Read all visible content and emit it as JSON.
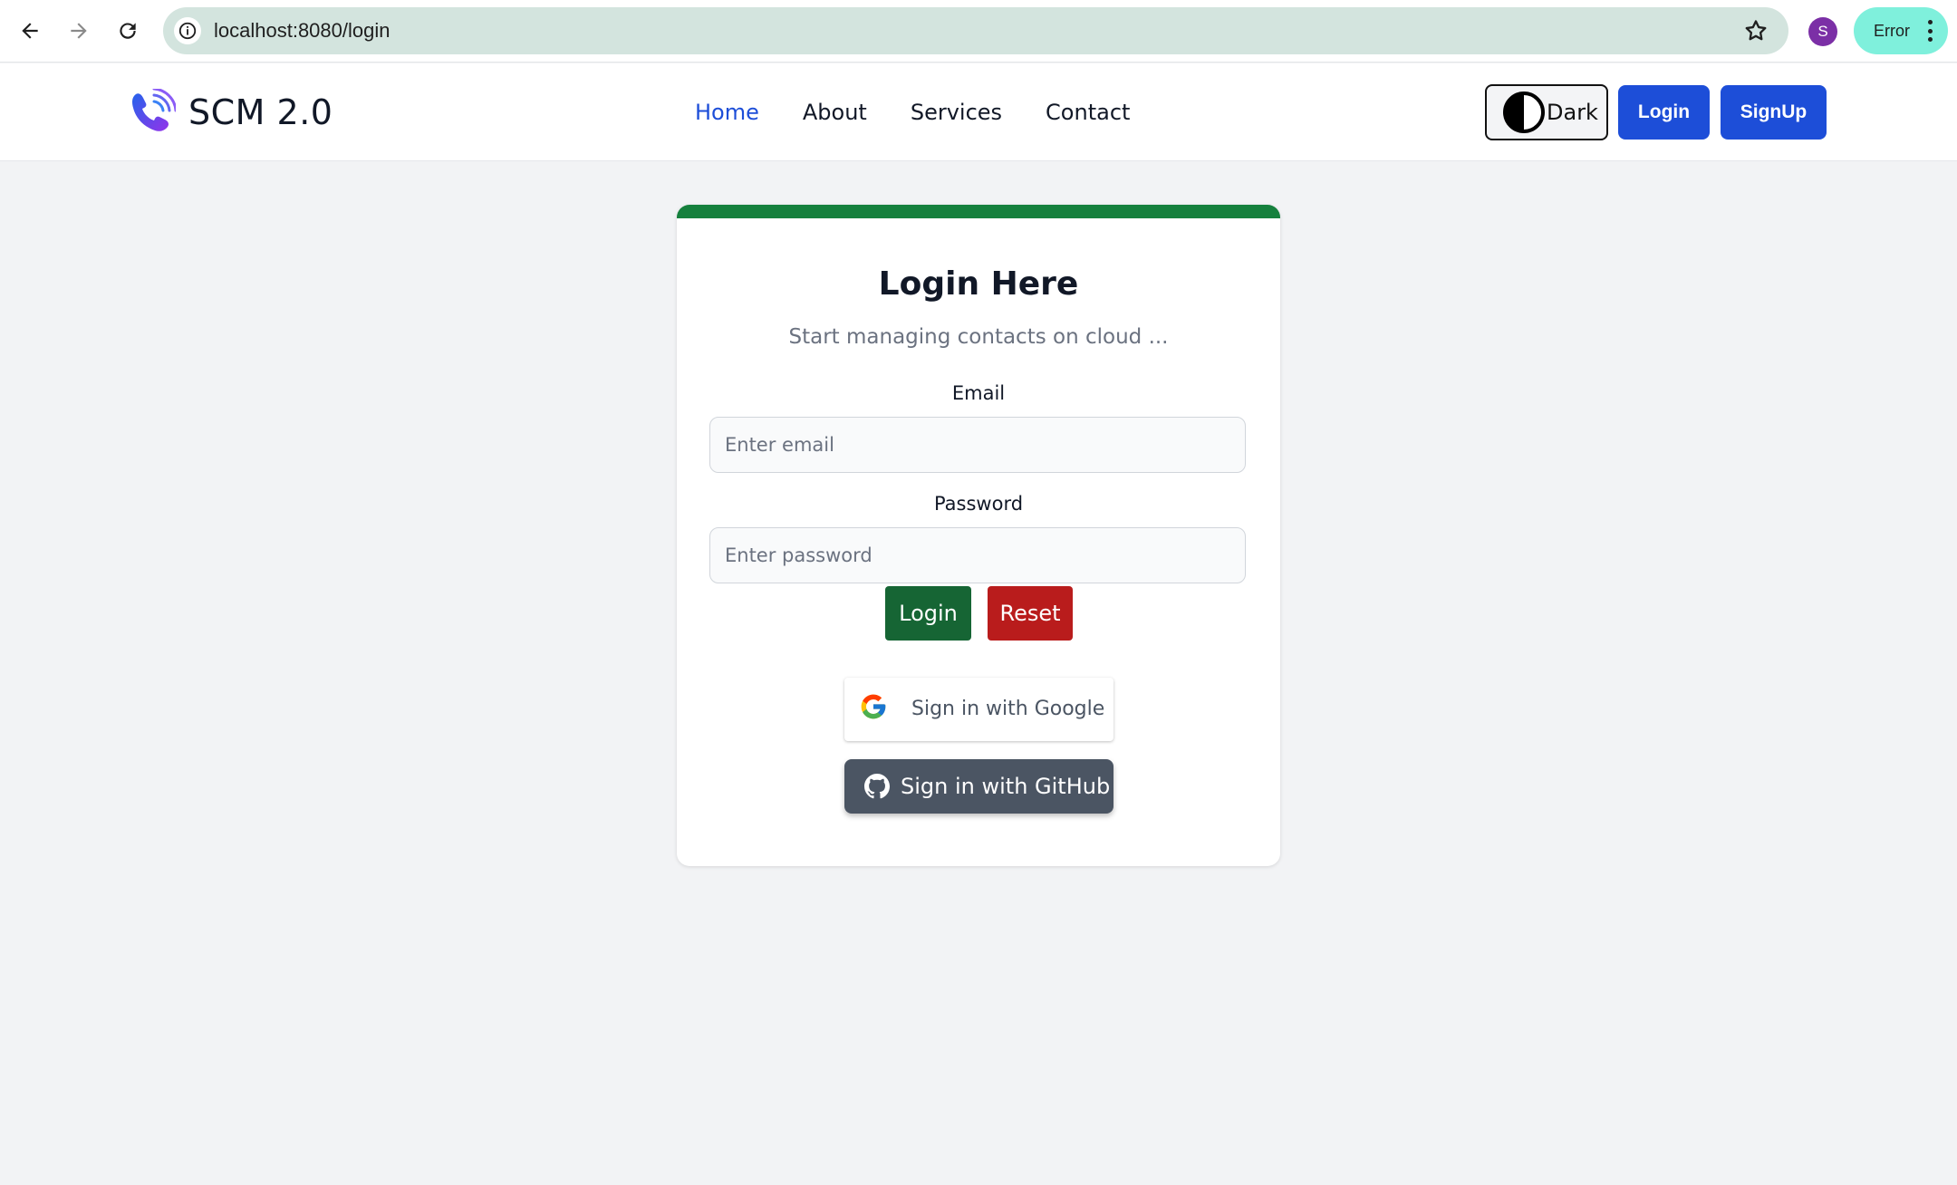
{
  "browser": {
    "url": "localhost:8080/login",
    "profile_initial": "S",
    "status_label": "Error"
  },
  "navbar": {
    "brand": "SCM 2.0",
    "menu": [
      "Home",
      "About",
      "Services",
      "Contact"
    ],
    "active_item": "Home",
    "theme_label": "Dark",
    "login_label": "Login",
    "signup_label": "SignUp"
  },
  "card": {
    "title": "Login Here",
    "subtitle": "Start managing contacts on cloud ...",
    "email_label": "Email",
    "email_placeholder": "Enter email",
    "password_label": "Password",
    "password_placeholder": "Enter password",
    "login_button": "Login",
    "reset_button": "Reset",
    "google_button": "Sign in with Google",
    "github_button": "Sign in with GitHub"
  },
  "colors": {
    "accent_blue": "#1d4ed8",
    "card_top_border": "#15803d",
    "login_green": "#166534",
    "reset_red": "#b91c1c",
    "github_gray": "#4b5563"
  }
}
